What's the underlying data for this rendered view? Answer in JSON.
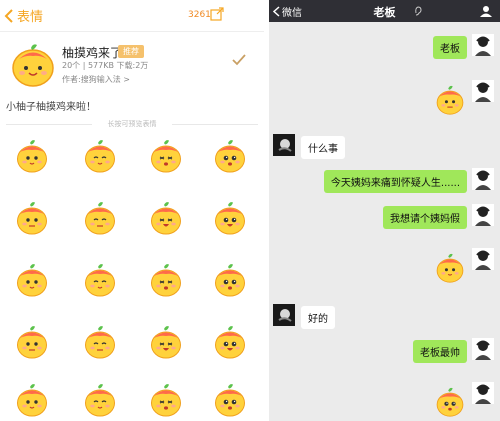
{
  "left": {
    "back_label": "表情",
    "count": "3261",
    "pack": {
      "title": "柚摸鸡来了",
      "tag": "推荐",
      "meta": "20个 | 577KB  下载:2万",
      "author": "作者:搜狗输入法 >"
    },
    "description": "小柚子柚摸鸡来啦！",
    "section_label": "长按可预览表情",
    "emoji_names": [
      "yuzu-peek-icon",
      "yuzu-cover-face-icon",
      "yuzu-wave-icon",
      "yuzu-shy-icon",
      "yuzu-surprised-icon",
      "yuzu-annoyed-icon",
      "yuzu-angry-icon",
      "yuzu-rainbow-icon",
      "yuzu-heart-icon",
      "yuzu-thinking-icon",
      "yuzu-happy-icon",
      "yuzu-smug-icon",
      "yuzu-sleepy-icon",
      "yuzu-sulk-icon",
      "yuzu-scared-icon",
      "yuzu-blush-icon",
      "yuzu-faint-icon",
      "yuzu-cry-icon",
      "yuzu-laugh-icon",
      "yuzu-love-icon"
    ]
  },
  "right": {
    "back_label": "微信",
    "title": "老板",
    "colors": {
      "me_bubble": "#a0e75a",
      "topbar": "#2f2f35"
    },
    "messages": [
      {
        "side": "me",
        "type": "text",
        "text": "老板"
      },
      {
        "side": "me",
        "type": "sticker",
        "text": ""
      },
      {
        "side": "them",
        "type": "text",
        "text": "什么事"
      },
      {
        "side": "me",
        "type": "text",
        "text": "今天姨妈来痛到怀疑人生......"
      },
      {
        "side": "me",
        "type": "text",
        "text": "我想请个姨妈假"
      },
      {
        "side": "me",
        "type": "sticker",
        "text": ""
      },
      {
        "side": "them",
        "type": "text",
        "text": "好的"
      },
      {
        "side": "me",
        "type": "text",
        "text": "老板最帅"
      },
      {
        "side": "me",
        "type": "sticker",
        "text": ""
      }
    ]
  }
}
